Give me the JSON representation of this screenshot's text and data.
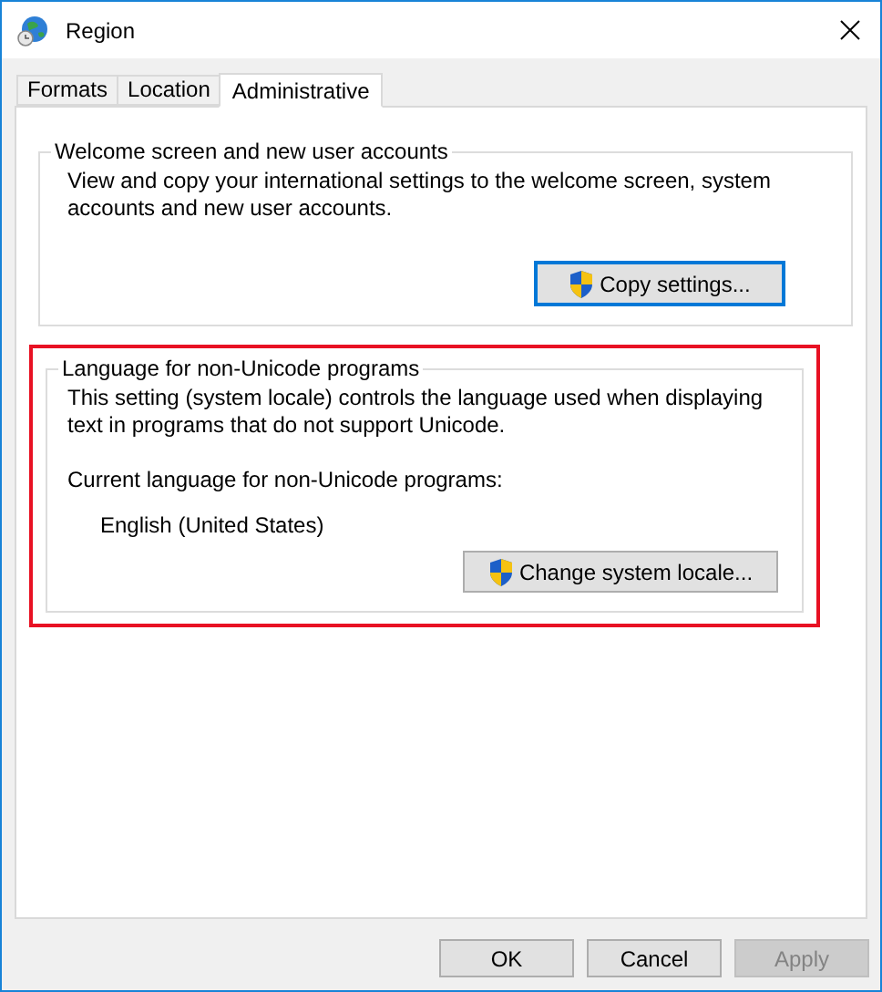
{
  "window": {
    "title": "Region"
  },
  "tabs": [
    {
      "label": "Formats",
      "selected": false
    },
    {
      "label": "Location",
      "selected": false
    },
    {
      "label": "Administrative",
      "selected": true
    }
  ],
  "welcome_group": {
    "title": "Welcome screen and new user accounts",
    "description": "View and copy your international settings to the welcome screen, system accounts and new user accounts.",
    "button": "Copy settings...",
    "highlighted": false
  },
  "locale_group": {
    "title": "Language for non-Unicode programs",
    "description": "This setting (system locale) controls the language used when displaying text in programs that do not support Unicode.",
    "current_label": "Current language for non-Unicode programs:",
    "current_value": "English (United States)",
    "button": "Change system locale...",
    "highlighted": true
  },
  "buttons": [
    {
      "label": "OK",
      "disabled": false
    },
    {
      "label": "Cancel",
      "disabled": false
    },
    {
      "label": "Apply",
      "disabled": true
    }
  ]
}
